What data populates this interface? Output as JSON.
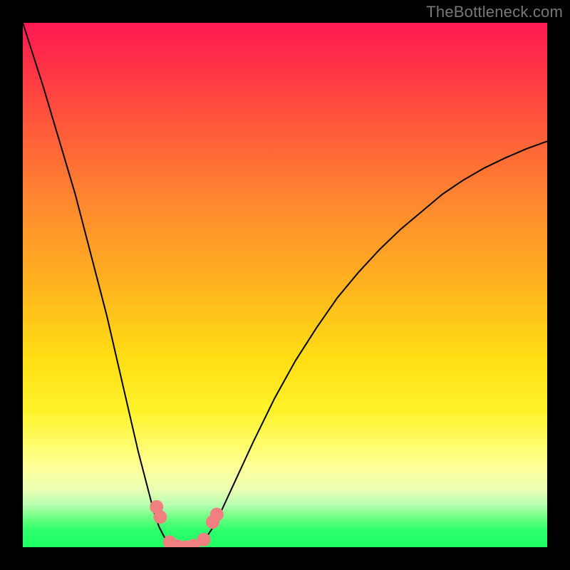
{
  "watermark": {
    "text": "TheBottleneck.com"
  },
  "colors": {
    "frame": "#000000",
    "curve": "#000000",
    "marker_fill": "#f08080",
    "marker_stroke": "#f08080"
  },
  "chart_data": {
    "type": "line",
    "title": "",
    "xlabel": "",
    "ylabel": "",
    "x": [
      0.0,
      0.02,
      0.04,
      0.06,
      0.08,
      0.1,
      0.12,
      0.14,
      0.16,
      0.18,
      0.2,
      0.22,
      0.24,
      0.25,
      0.26,
      0.27,
      0.28,
      0.29,
      0.3,
      0.305,
      0.31,
      0.32,
      0.33,
      0.34,
      0.35,
      0.36,
      0.38,
      0.4,
      0.44,
      0.48,
      0.52,
      0.56,
      0.6,
      0.64,
      0.68,
      0.72,
      0.76,
      0.8,
      0.84,
      0.88,
      0.92,
      0.96,
      1.0
    ],
    "values": [
      1.04,
      0.975,
      0.91,
      0.84,
      0.77,
      0.7,
      0.62,
      0.54,
      0.46,
      0.37,
      0.28,
      0.19,
      0.11,
      0.07,
      0.04,
      0.02,
      0.01,
      0.004,
      0.001,
      0.0,
      0.0,
      0.001,
      0.004,
      0.01,
      0.02,
      0.035,
      0.075,
      0.12,
      0.21,
      0.295,
      0.37,
      0.435,
      0.495,
      0.545,
      0.59,
      0.63,
      0.665,
      0.7,
      0.728,
      0.752,
      0.772,
      0.79,
      0.805
    ],
    "xlim": [
      0,
      1
    ],
    "ylim": [
      0,
      1.04
    ],
    "markers": [
      {
        "x": 0.255,
        "y": 0.08
      },
      {
        "x": 0.262,
        "y": 0.06
      },
      {
        "x": 0.28,
        "y": 0.01
      },
      {
        "x": 0.295,
        "y": 0.002
      },
      {
        "x": 0.31,
        "y": 0.0
      },
      {
        "x": 0.325,
        "y": 0.003
      },
      {
        "x": 0.345,
        "y": 0.015
      },
      {
        "x": 0.362,
        "y": 0.05
      },
      {
        "x": 0.37,
        "y": 0.065
      }
    ],
    "marker_radius": 9
  }
}
